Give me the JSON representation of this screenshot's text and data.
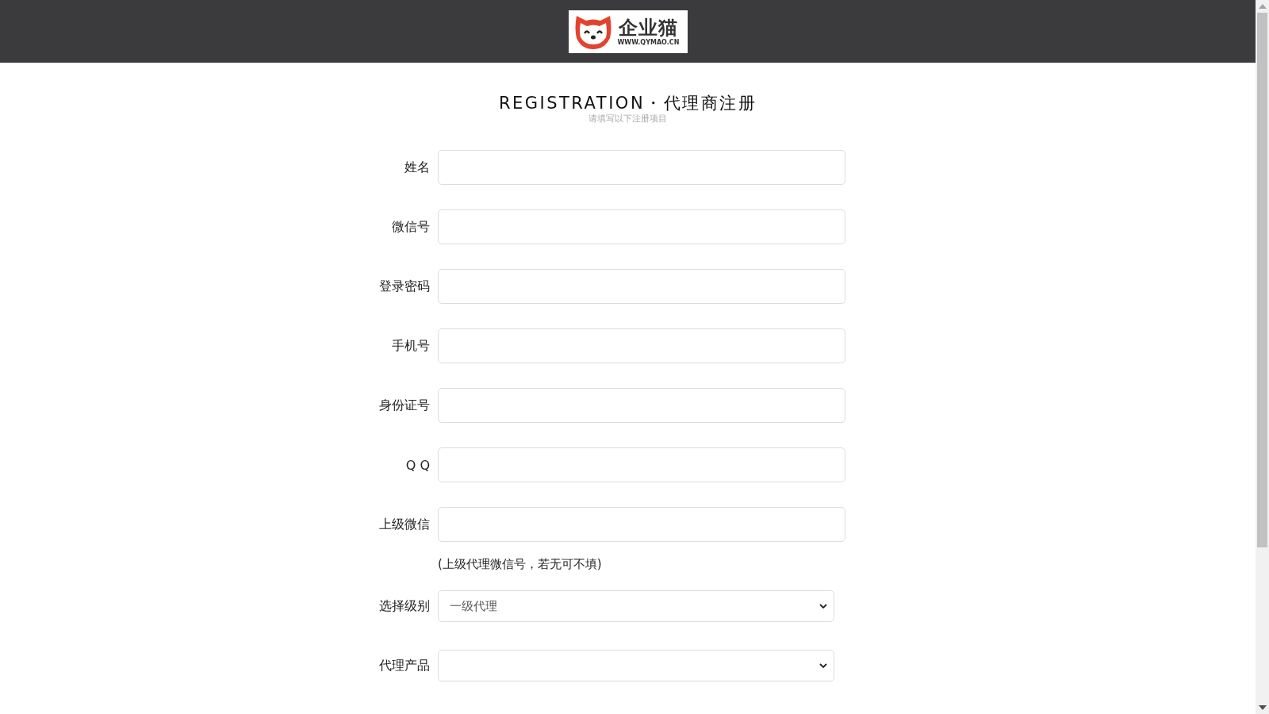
{
  "header": {
    "logo": {
      "name": "企业猫",
      "url": "WWW.QYMAO.CN"
    }
  },
  "heading": {
    "title": "REGISTRATION・代理商注册",
    "subtitle": "请填写以下注册项目"
  },
  "fields": [
    {
      "kind": "text",
      "label": "姓名"
    },
    {
      "kind": "text",
      "label": "微信号"
    },
    {
      "kind": "text",
      "label": "登录密码"
    },
    {
      "kind": "text",
      "label": "手机号"
    },
    {
      "kind": "text",
      "label": "身份证号"
    },
    {
      "kind": "text",
      "label": "Q Q"
    },
    {
      "kind": "text",
      "label": "上级微信"
    },
    {
      "kind": "hint",
      "text": "(上级代理微信号，若无可不填)"
    },
    {
      "kind": "select",
      "label": "选择级别",
      "value": "一级代理"
    },
    {
      "kind": "select",
      "label": "代理产品"
    }
  ]
}
